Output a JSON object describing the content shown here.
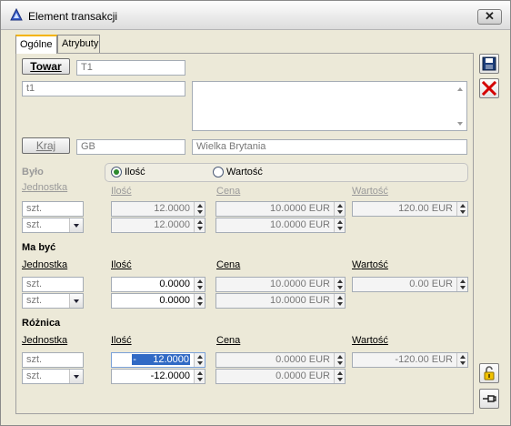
{
  "window": {
    "title": "Element transakcji",
    "close_label": "✕"
  },
  "tabs": [
    {
      "label": "Ogólne"
    },
    {
      "label": "Atrybuty"
    }
  ],
  "towar": {
    "button_label": "Towar",
    "code": "T1",
    "name": "t1"
  },
  "kraj": {
    "button_label": "Kraj",
    "code": "GB",
    "name": "Wielka Brytania"
  },
  "bylo": {
    "heading": "Było",
    "unit_label": "Jednostka",
    "radio_ilosc": "Ilość",
    "radio_wartosc": "Wartość",
    "col_ilosc": "Ilość",
    "col_cena": "Cena",
    "col_wartosc": "Wartość",
    "unit1": "szt.",
    "unit2": "szt.",
    "qty1": "12.0000",
    "qty2": "12.0000",
    "price1": "10.0000 EUR",
    "price2": "10.0000 EUR",
    "value1": "120.00 EUR"
  },
  "ma_byc": {
    "heading": "Ma być",
    "unit_label": "Jednostka",
    "col_ilosc": "Ilość",
    "col_cena": "Cena",
    "col_wartosc": "Wartość",
    "unit1": "szt.",
    "unit2": "szt.",
    "qty1": "0.0000",
    "qty2": "0.0000",
    "price1": "10.0000 EUR",
    "price2": "10.0000 EUR",
    "value1": "0.00 EUR"
  },
  "roznica": {
    "heading": "Różnica",
    "unit_label": "Jednostka",
    "col_ilosc": "Ilość",
    "col_cena": "Cena",
    "col_wartosc": "Wartość",
    "unit1": "szt.",
    "unit2": "szt.",
    "qty1_sign": "-",
    "qty1": "12.0000",
    "qty2": "-12.0000",
    "price1": "0.0000 EUR",
    "price2": "0.0000 EUR",
    "value1": "-120.00 EUR"
  },
  "side_icons": {
    "save": "save-icon",
    "cancel": "cancel-icon",
    "lock": "lock-icon",
    "pin": "pin-icon"
  },
  "colors": {
    "accent": "#316ac5",
    "tab_highlight": "#f4b400",
    "cancel_red": "#d40000"
  }
}
